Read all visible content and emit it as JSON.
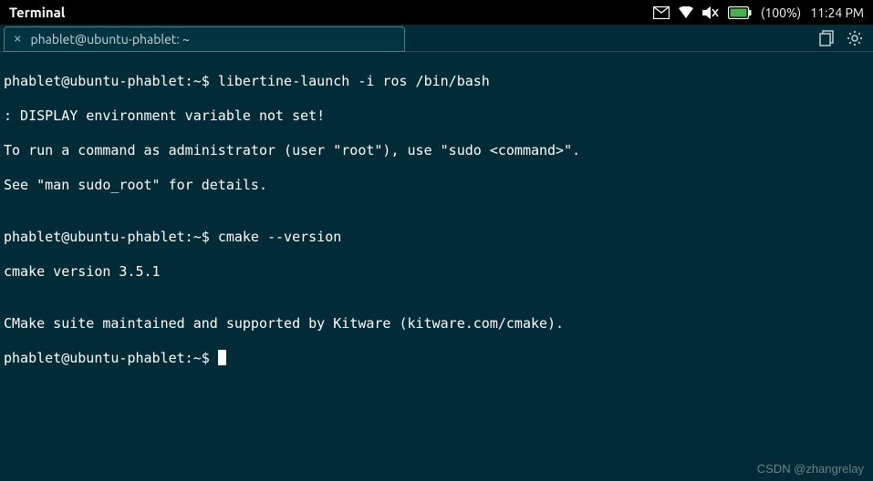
{
  "topbar": {
    "app_title": "Terminal",
    "battery_pct": "(100%)",
    "clock": "11:24 PM"
  },
  "tab": {
    "title": "phablet@ubuntu-phablet: ~"
  },
  "terminal": {
    "line1_prompt": "phablet@ubuntu-phablet:~$ ",
    "line1_cmd": "libertine-launch -i ros /bin/bash",
    "line2": ": DISPLAY environment variable not set!",
    "line3": "To run a command as administrator (user \"root\"), use \"sudo <command>\".",
    "line4": "See \"man sudo_root\" for details.",
    "line5": "",
    "line6_prompt": "phablet@ubuntu-phablet:~$ ",
    "line6_cmd": "cmake --version",
    "line7": "cmake version 3.5.1",
    "line8": "",
    "line9": "CMake suite maintained and supported by Kitware (kitware.com/cmake).",
    "line10_prompt": "phablet@ubuntu-phablet:~$ "
  },
  "watermark": "CSDN @zhangrelay"
}
